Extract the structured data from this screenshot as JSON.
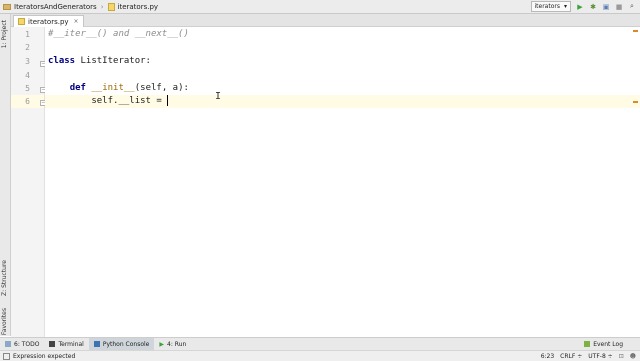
{
  "breadcrumb": {
    "project": "IteratorsAndGenerators",
    "file": "iterators.py"
  },
  "toolbar": {
    "run_config": "iterators",
    "dropdown_icon": "chevron-down-icon",
    "run_icon": "play-icon",
    "debug_icon": "bug-icon"
  },
  "tab": {
    "label": "iterators.py",
    "close": "×"
  },
  "left_strip": {
    "project": "1: Project",
    "structure": "Z: Structure",
    "favorites": "2: Favorites"
  },
  "editor": {
    "line_numbers": [
      "1",
      "2",
      "3",
      "4",
      "5",
      "6"
    ],
    "line1": "#__iter__() and __next__()",
    "line3_kw": "class",
    "line3_rest": " ListIterator:",
    "line5_indent": "    ",
    "line5_kw": "def",
    "line5_fn": "__init__",
    "line5_rest": "(self, a):",
    "line6": "        self.__list = "
  },
  "bottom_tools": {
    "todo": "6: TODO",
    "terminal": "Terminal",
    "python_console": "Python Console",
    "run": "4: Run",
    "event_log": "Event Log"
  },
  "status": {
    "message": "Expression expected",
    "position": "6:23",
    "line_sep": "CRLF ÷",
    "encoding": "UTF-8 ÷"
  },
  "colors": {
    "keyword": "#000080",
    "comment": "#8c8c8c",
    "function": "#9a6b00",
    "current_line": "#fffbe4"
  }
}
